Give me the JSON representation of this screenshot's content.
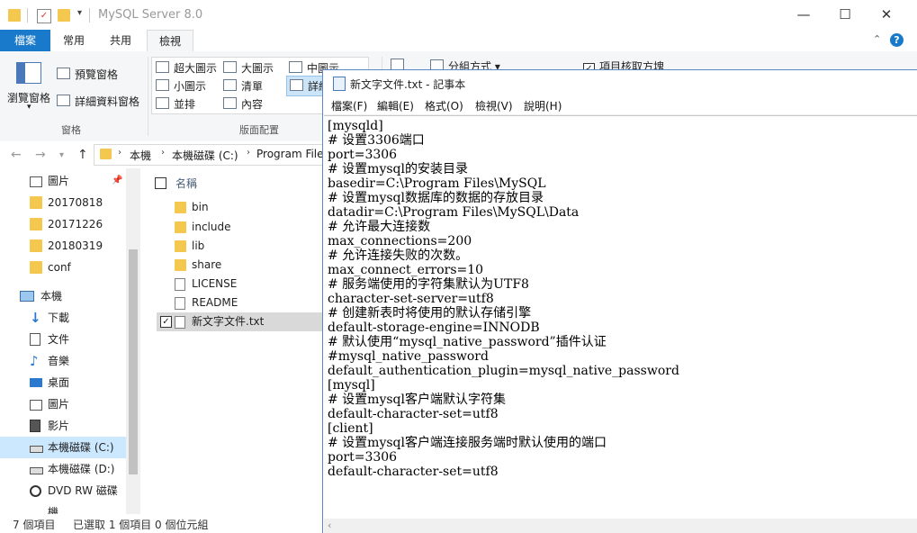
{
  "explorer": {
    "title": "MySQL Server 8.0",
    "tabs": [
      "檔案",
      "常用",
      "共用",
      "檢視"
    ],
    "ribbon": {
      "panes": {
        "nav_pane": "瀏覽窗格",
        "preview_pane": "預覽窗格",
        "details_pane": "詳細資料窗格",
        "group_label": "窗格"
      },
      "layout": {
        "extra_large": "超大圖示",
        "large": "大圖示",
        "medium": "中圖示",
        "small": "小圖示",
        "list": "清單",
        "details": "詳細",
        "tiles": "並排",
        "content": "內容",
        "group_label": "版面配置"
      },
      "current_view": {
        "sort_by": "分組方式",
        "item_checkboxes": "項目核取方塊"
      }
    },
    "address": {
      "parts": [
        "本機",
        "本機磁碟 (C:)",
        "Program Files"
      ]
    },
    "nav_items": [
      {
        "label": "圖片",
        "icon": "pictures-icon"
      },
      {
        "label": "20170818",
        "icon": "folder-icon"
      },
      {
        "label": "20171226",
        "icon": "folder-icon"
      },
      {
        "label": "20180319",
        "icon": "folder-icon"
      },
      {
        "label": "conf",
        "icon": "folder-icon"
      },
      {
        "label": "本機",
        "icon": "this-pc-icon"
      },
      {
        "label": "下載",
        "icon": "download-icon"
      },
      {
        "label": "文件",
        "icon": "documents-icon"
      },
      {
        "label": "音樂",
        "icon": "music-icon"
      },
      {
        "label": "桌面",
        "icon": "desktop-icon"
      },
      {
        "label": "圖片",
        "icon": "pictures-icon"
      },
      {
        "label": "影片",
        "icon": "videos-icon"
      },
      {
        "label": "本機磁碟 (C:)",
        "icon": "drive-icon"
      },
      {
        "label": "本機磁碟 (D:)",
        "icon": "drive-icon"
      },
      {
        "label": "DVD RW 磁碟機",
        "icon": "dvd-icon"
      }
    ],
    "column_header": "名稱",
    "files": [
      {
        "name": "bin",
        "type": "folder"
      },
      {
        "name": "include",
        "type": "folder"
      },
      {
        "name": "lib",
        "type": "folder"
      },
      {
        "name": "share",
        "type": "folder"
      },
      {
        "name": "LICENSE",
        "type": "file"
      },
      {
        "name": "README",
        "type": "file"
      },
      {
        "name": "新文字文件.txt",
        "type": "txt"
      }
    ],
    "status": {
      "count": "7 個項目",
      "selected": "已選取 1 個項目",
      "size": "0 個位元組"
    }
  },
  "notepad": {
    "title": "新文字文件.txt - 記事本",
    "menu": [
      "檔案(F)",
      "編輯(E)",
      "格式(O)",
      "檢視(V)",
      "說明(H)"
    ],
    "lines": [
      "[mysqld]",
      "# 设置3306端口",
      "port=3306",
      "# 设置mysql的安装目录",
      "basedir=C:\\Program Files\\MySQL",
      "# 设置mysql数据库的数据的存放目录",
      "datadir=C:\\Program Files\\MySQL\\Data",
      "# 允许最大连接数",
      "max_connections=200",
      "# 允许连接失败的次数。",
      "max_connect_errors=10",
      "# 服务端使用的字符集默认为UTF8",
      "character-set-server=utf8",
      "# 创建新表时将使用的默认存储引擎",
      "default-storage-engine=INNODB",
      "# 默认使用“mysql_native_password”插件认证",
      "#mysql_native_password",
      "default_authentication_plugin=mysql_native_password",
      "[mysql]",
      "# 设置mysql客户端默认字符集",
      "default-character-set=utf8",
      "[client]",
      "# 设置mysql客户端连接服务端时默认使用的端口",
      "port=3306",
      "default-character-set=utf8"
    ]
  }
}
